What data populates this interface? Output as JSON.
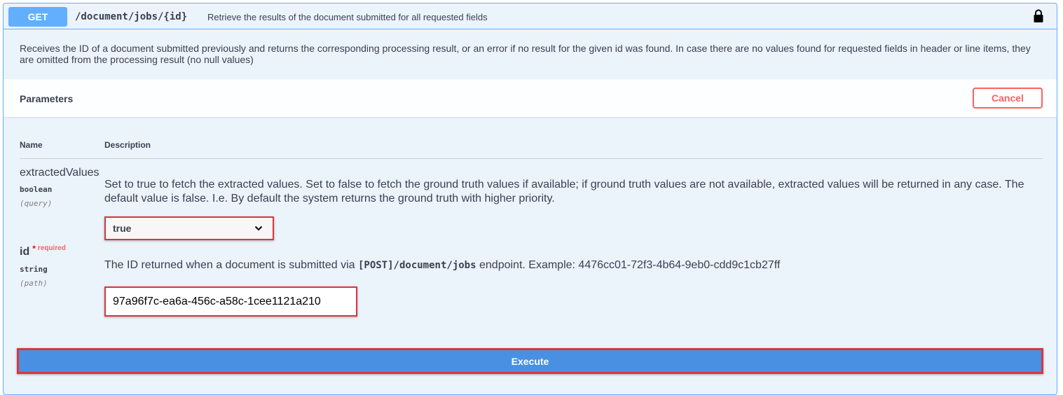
{
  "summary": {
    "method": "GET",
    "path": "/document/jobs/{id}",
    "description": "Retrieve the results of the document submitted for all requested fields"
  },
  "description": "Receives the ID of a document submitted previously and returns the corresponding processing result, or an error if no result for the given id was found. In case there are no values found for requested fields in header or line items, they are omitted from the processing result (no null values)",
  "parameters": {
    "title": "Parameters",
    "cancel_label": "Cancel",
    "col_name": "Name",
    "col_description": "Description",
    "items": [
      {
        "name": "extractedValues",
        "type": "boolean",
        "in": "(query)",
        "description": "Set to true to fetch the extracted values. Set to false to fetch the ground truth values if available; if ground truth values are not available, extracted values will be returned in any case. The default value is false. I.e. By default the system returns the ground truth with higher priority.",
        "selected_value": "true"
      },
      {
        "name": "id",
        "required_star": "*",
        "required_label": "required",
        "type": "string",
        "in": "(path)",
        "description_pre": "The ID returned when a document is submitted via ",
        "description_code": "[POST]/document/jobs",
        "description_post": " endpoint. Example: 4476cc01-72f3-4b64-9eb0-cdd9c1cb27ff",
        "value": "97a96f7c-ea6a-456c-a58c-1cee1121a210"
      }
    ]
  },
  "execute_label": "Execute",
  "colors": {
    "method_bg": "#61affe",
    "execute_bg": "#4990e2",
    "cancel": "#ff6060",
    "highlight_border": "#d9363e"
  }
}
